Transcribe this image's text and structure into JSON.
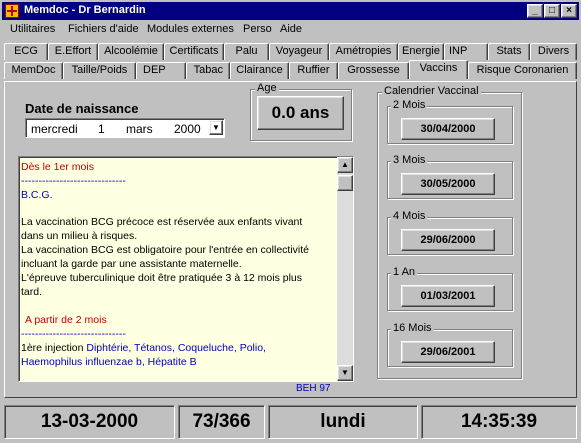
{
  "window": {
    "title": "Memdoc - Dr Bernardin",
    "app_icon": "medical-cross-icon",
    "controls": {
      "minimize": "_",
      "maximize": "□",
      "close": "×"
    }
  },
  "menu": [
    "Utilitaires",
    "Fichiers d'aide",
    "Modules externes",
    "Perso",
    "Aide"
  ],
  "tabs_row1": [
    "ECG",
    "E.Effort",
    "Alcoolémie",
    "Certificats",
    "Palu",
    "Voyageur",
    "Amétropies",
    "Energie",
    "INP",
    "Stats",
    "Divers"
  ],
  "tabs_row2": [
    "MemDoc",
    "Taille/Poids",
    "DEP",
    "Tabac",
    "Clairance",
    "Ruffier",
    "Grossesse",
    "Vaccins",
    "Risque Coronarien"
  ],
  "active_tab": "Vaccins",
  "birth": {
    "label": "Date de naissance",
    "weekday": "mercredi",
    "day": "1",
    "month": "mars",
    "year": "2000",
    "dropdown_icon": "▼"
  },
  "age": {
    "label": "Age",
    "value": "0.0 ans"
  },
  "calendar": {
    "title": "Calendrier Vaccinal",
    "items": [
      {
        "label": "2 Mois",
        "date": "30/04/2000"
      },
      {
        "label": "3 Mois",
        "date": "30/05/2000"
      },
      {
        "label": "4 Mois",
        "date": "29/06/2000"
      },
      {
        "label": "1 An",
        "date": "01/03/2001"
      },
      {
        "label": "16 Mois",
        "date": "29/06/2001"
      }
    ]
  },
  "notes": {
    "lines": [
      "Dès le 1er mois",
      "------------------------------",
      "B.C.G.",
      "La vaccination BCG précoce est réservée aux enfants vivant",
      "dans un milieu à risques.",
      "La vaccination BCG est obligatoire pour l'entrée en collectivité",
      "incluant la garde par une assistante maternelle.",
      "L'épreuve tuberculinique doit être pratiquée 3 à 12 mois plus",
      "tard.",
      "A partir de 2 mois",
      "------------------------------",
      "1ère injection ",
      "Diphtérie, Tétanos, Coqueluche, Polio,",
      "Haemophilus influenzae b, Hépatite B"
    ],
    "source": "BEH 97",
    "scroll_up": "▲",
    "scroll_down": "▼"
  },
  "status": {
    "date": "13-03-2000",
    "day_of_year": "73/366",
    "weekday": "lundi",
    "time": "14:35:39"
  }
}
